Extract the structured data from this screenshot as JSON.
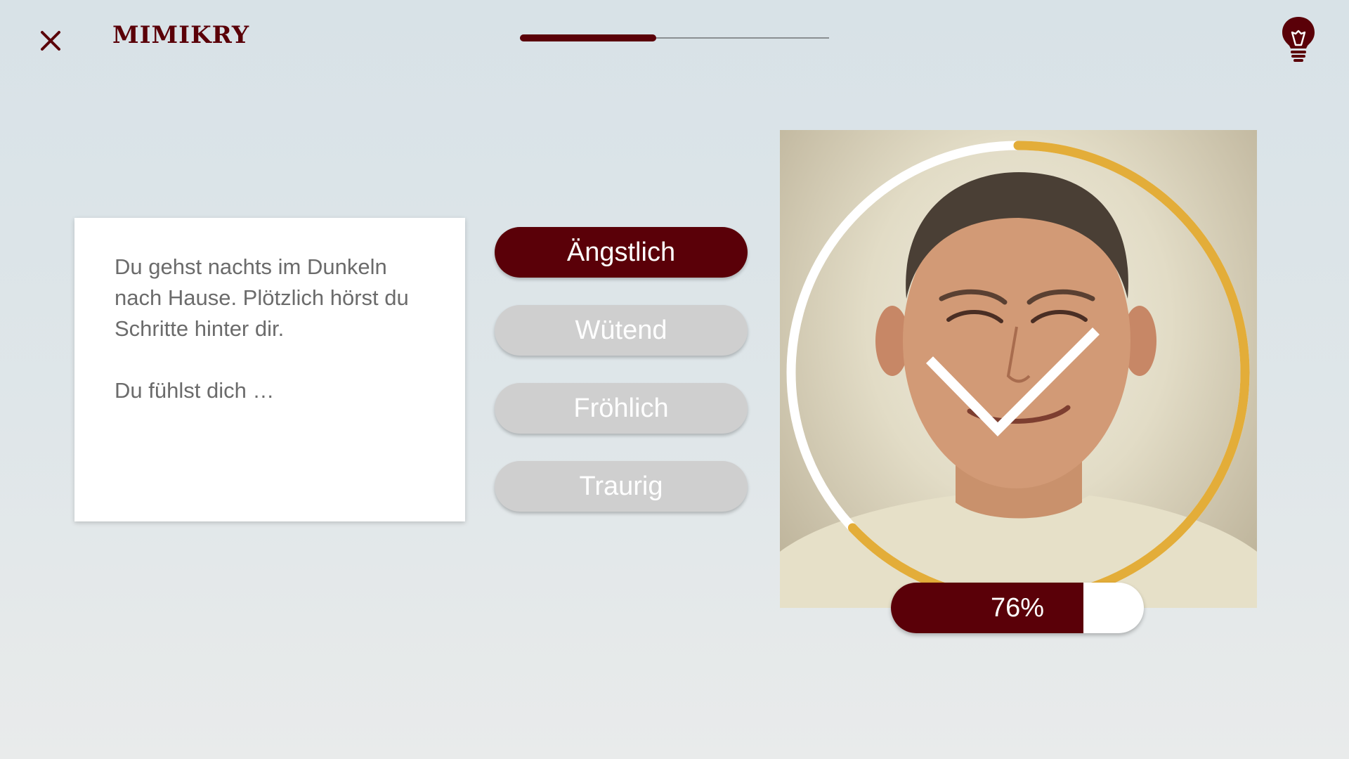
{
  "header": {
    "title": "MIMIKRY",
    "progress_fraction": 0.44,
    "close_icon": "close-icon",
    "hint_icon": "lightbulb-icon"
  },
  "story": {
    "text": "Du gehst nachts im Dunkeln nach Hause. Plötzlich hörst du Schritte hinter dir.",
    "prompt": "Du fühlst dich …"
  },
  "answers": [
    {
      "label": "Ängstlich",
      "selected": true
    },
    {
      "label": "Wütend",
      "selected": false
    },
    {
      "label": "Fröhlich",
      "selected": false
    },
    {
      "label": "Traurig",
      "selected": false
    }
  ],
  "result": {
    "score_label": "76%",
    "score_fraction": 0.76,
    "ring_fraction": 0.63,
    "check_icon": "checkmark-icon"
  },
  "colors": {
    "primary": "#5a0008",
    "inactive": "#cfcfcf",
    "ring_accent": "#e3ad39",
    "ring_track": "#ffffff"
  }
}
